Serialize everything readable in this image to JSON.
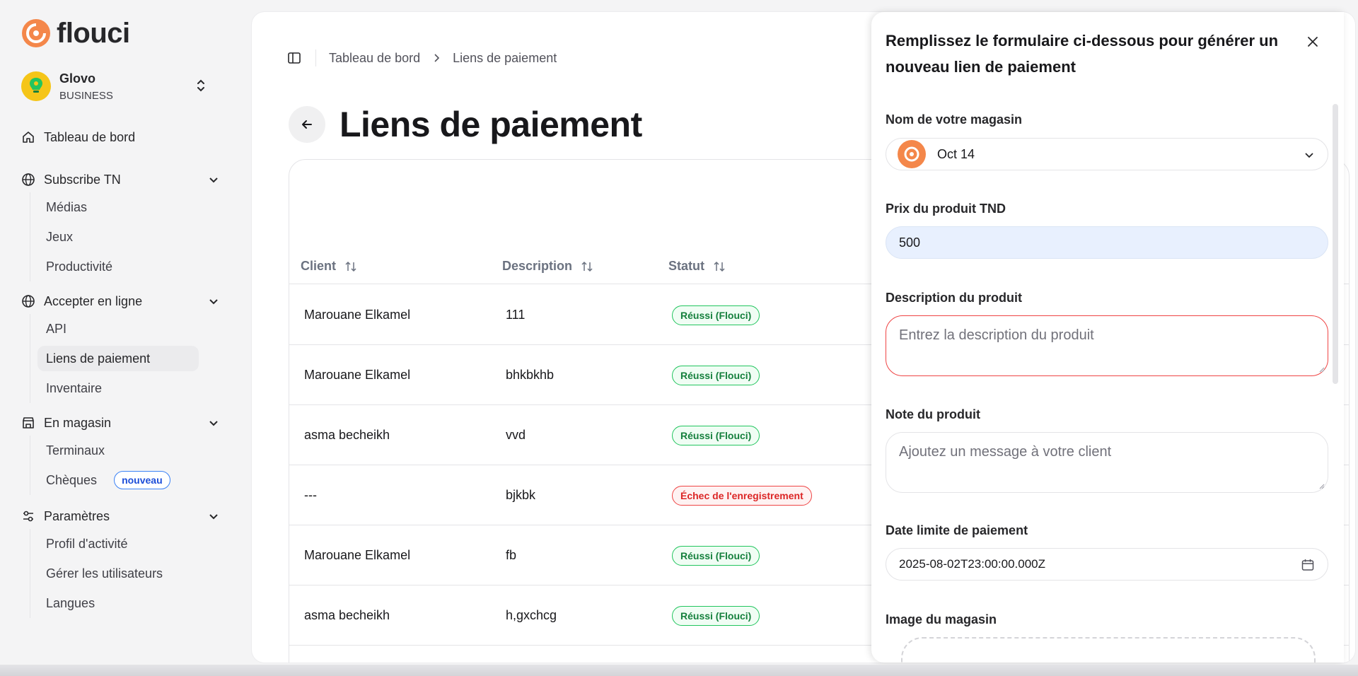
{
  "brand": {
    "name": "flouci",
    "accent": "#f4874a"
  },
  "organization": {
    "name": "Glovo",
    "type": "BUSINESS"
  },
  "nav": {
    "dashboard": "Tableau de bord",
    "groups": [
      {
        "label": "Subscribe TN",
        "items": [
          "Médias",
          "Jeux",
          "Productivité"
        ]
      },
      {
        "label": "Accepter en ligne",
        "items": [
          "API",
          "Liens de paiement",
          "Inventaire"
        ]
      },
      {
        "label": "En magasin",
        "items": [
          "Terminaux",
          "Chèques"
        ],
        "badge": "nouveau"
      },
      {
        "label": "Paramètres",
        "items": [
          "Profil d'activité",
          "Gérer les utilisateurs",
          "Langues"
        ]
      }
    ]
  },
  "breadcrumb": {
    "home": "Tableau de bord",
    "current": "Liens de paiement"
  },
  "page": {
    "title": "Liens de paiement"
  },
  "table": {
    "columns": [
      "Client",
      "Description",
      "Statut"
    ],
    "rows": [
      {
        "client": "Marouane Elkamel",
        "description": "111",
        "status": "Réussi (Flouci)",
        "ok": true
      },
      {
        "client": "Marouane Elkamel",
        "description": "bhkbkhb",
        "status": "Réussi (Flouci)",
        "ok": true
      },
      {
        "client": "asma becheikh",
        "description": "vvd",
        "status": "Réussi (Flouci)",
        "ok": true
      },
      {
        "client": "---",
        "description": "bjkbk",
        "status": "Échec de l'enregistrement",
        "ok": false
      },
      {
        "client": "Marouane Elkamel",
        "description": "fb",
        "status": "Réussi (Flouci)",
        "ok": true
      },
      {
        "client": "asma becheikh",
        "description": "h,gxchcg",
        "status": "Réussi (Flouci)",
        "ok": true
      }
    ]
  },
  "drawer": {
    "title": "Remplissez le formulaire ci-dessous pour générer un nouveau lien de paiement",
    "store_label": "Nom de votre magasin",
    "store_value": "Oct 14",
    "price_label": "Prix du produit TND",
    "price_value": "500",
    "description_label": "Description du produit",
    "description_placeholder": "Entrez la description du produit",
    "note_label": "Note du produit",
    "note_placeholder": "Ajoutez un message à votre client",
    "deadline_label": "Date limite de paiement",
    "deadline_value": "2025-08-02T23:00:00.000Z",
    "image_label": "Image du magasin"
  }
}
